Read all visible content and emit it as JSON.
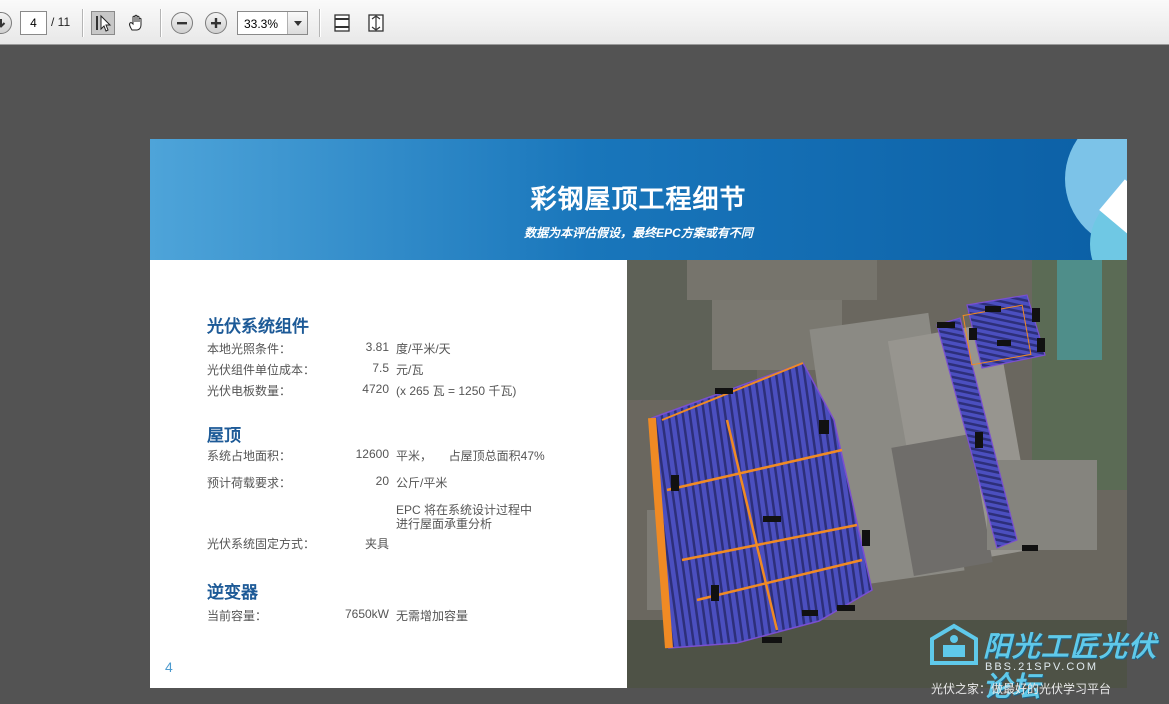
{
  "toolbar": {
    "page_current": "4",
    "page_total": "/ 11",
    "zoom": "33.3%",
    "icons": {
      "prev": "arrow-down-icon",
      "select": "select-cursor-icon",
      "hand": "hand-icon",
      "zoom_out": "zoom-out-icon",
      "zoom_in": "zoom-in-icon",
      "fit_width": "fit-width-icon",
      "fit_page": "fit-page-icon"
    }
  },
  "slide": {
    "title": "彩钢屋顶工程细节",
    "subtitle": "数据为本评估假设，最终EPC方案或有不同",
    "page_number": "4",
    "sections": {
      "pv": {
        "heading": "光伏系统组件",
        "rows": [
          {
            "label": "本地光照条件：",
            "value": "3.81",
            "unit": "度/平米/天"
          },
          {
            "label": "光伏组件单位成本：",
            "value": "7.5",
            "unit": "元/瓦"
          },
          {
            "label": "光伏电板数量：",
            "value": "4720",
            "unit": "(x 265 瓦 = 1250 千瓦)"
          }
        ]
      },
      "roof": {
        "heading": "屋顶",
        "rows": [
          {
            "label": "系统占地面积：",
            "value": "12600",
            "unit": "平米，     占屋顶总面积47%"
          },
          {
            "label": "预计荷载要求：",
            "value": "20",
            "unit": "公斤/平米"
          },
          {
            "label": "",
            "value": "",
            "unit": "EPC 将在系统设计过程中"
          },
          {
            "label": "",
            "value": "",
            "unit": "进行屋面承重分析"
          },
          {
            "label": "光伏系统固定方式：",
            "value": "夹具",
            "unit": ""
          }
        ]
      },
      "inverter": {
        "heading": "逆变器",
        "rows": [
          {
            "label": "当前容量：",
            "value": "7650kW",
            "unit": "无需增加容量"
          }
        ]
      }
    }
  },
  "watermark": {
    "main": "阳光工匠光伏论坛",
    "url": "BBS.21SPV.COM",
    "tagline": "光伏之家：做最好的光伏学习平台"
  },
  "colors": {
    "heading_blue": "#1d5a97",
    "banner_start": "#4ea4d9",
    "banner_end": "#0b5fa5",
    "array_orange": "#f08a24",
    "panel_blue": "#3b3fa8"
  }
}
